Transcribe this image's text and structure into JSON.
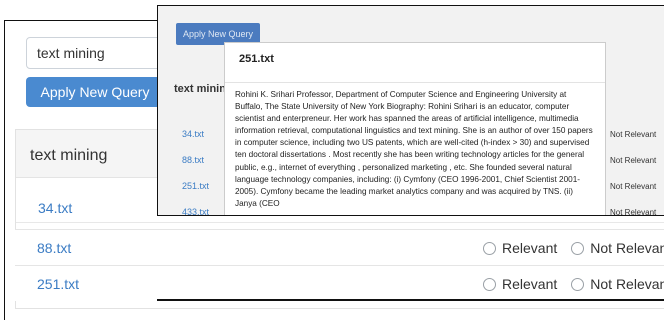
{
  "back": {
    "query_value": "text mining",
    "apply_button": "Apply New Query",
    "panel_title": "text mining",
    "rows": [
      {
        "file": "34.txt"
      },
      {
        "file": "88.txt",
        "relevant": "Relevant",
        "not_relevant": "Not Relevant"
      },
      {
        "file": "251.txt",
        "relevant": "Relevant",
        "not_relevant": "Not Relevant"
      }
    ]
  },
  "front": {
    "apply_button": "Apply New Query",
    "query_label": "text mining",
    "rows": [
      {
        "file": "34.txt",
        "not_relevant": "Not Relevant"
      },
      {
        "file": "88.txt",
        "not_relevant": "Not Relevant"
      },
      {
        "file": "251.txt",
        "not_relevant": "Not Relevant"
      },
      {
        "file": "433.txt",
        "not_relevant": "Not Relevant"
      }
    ],
    "modal": {
      "title": "251.txt",
      "body": "Rohini K. Srihari Professor, Department of Computer Science and Engineering University at Buffalo, The State University of New York Biography: Rohini Srihari is an educator, computer scientist and enterpreneur. Her work has spanned the areas of artificial intelligence, multimedia information retrieval, computational linguistics and text mining. She is an author of over 150 papers in computer science, including two US patents, which are well-cited (h-index > 30) and supervised ten doctoral dissertations . Most recently she has been writing technology articles for the general public, e.g., internet of everything , personalized marketing , etc. She founded several natural language technology companies, including: (i) Cymfony (CEO 1996-2001, Chief Scientist 2001-2005). Cymfony became the leading market analytics company and was acquired by TNS. (ii) Janya (CEO"
    }
  }
}
